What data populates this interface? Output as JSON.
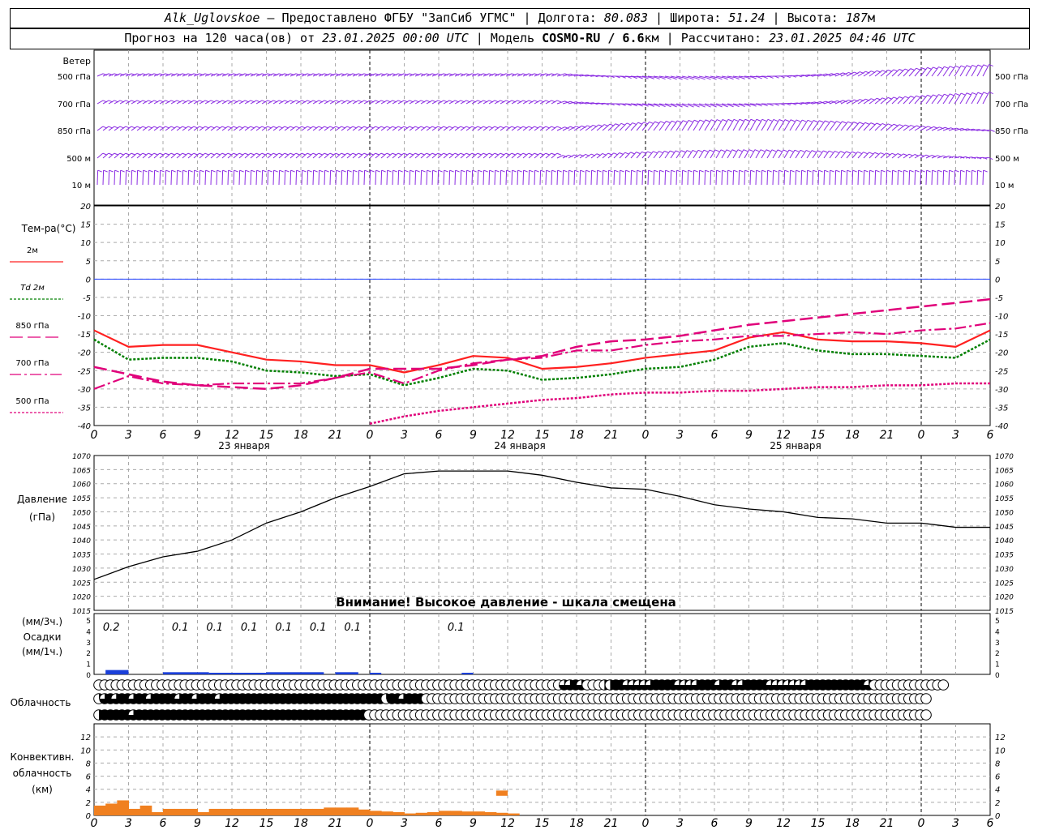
{
  "header": {
    "station": "Alk_Uglovskoe",
    "provider": "Предоставлено ФГБУ \"ЗапСиб УГМС\"",
    "lon_label": "Долгота:",
    "lon": "80.083",
    "lat_label": "Широта:",
    "lat": "51.24",
    "alt_label": "Высота:",
    "alt": "187",
    "alt_unit": "м",
    "forecast_prefix": "Прогноз на 120 часа(ов) от",
    "forecast_start": "23.01.2025 00:00 UTC",
    "model_label": "Модель",
    "model": "COSMO-RU / 6.6",
    "model_unit": "км",
    "calc_label": "Рассчитано:",
    "calc_time": "23.01.2025 04:46 UTC"
  },
  "labels": {
    "wind": "Ветер",
    "wind_levels": [
      "500 гПа",
      "700 гПа",
      "850 гПа",
      "500 м",
      "10 м"
    ],
    "temp": "Тем-ра(°С)",
    "temp_legend": [
      "2м",
      "Td  2м",
      "850 гПа",
      "700 гПа",
      "500 гПа"
    ],
    "pressure": "Давление",
    "pressure_unit": "(гПа)",
    "warning": "Внимание! Высокое давление - шкала смещена",
    "precip_unit3": "(мм/3ч.)",
    "precip": "Осадки",
    "precip_unit1": "(мм/1ч.)",
    "cloud": "Облачность",
    "conv1": "Конвективн.",
    "conv2": "облачность",
    "conv3": "(км)"
  },
  "time_axis": {
    "hour_ticks": [
      "0",
      "3",
      "6",
      "9",
      "12",
      "15",
      "18",
      "21",
      "0",
      "3",
      "6",
      "9",
      "12",
      "15",
      "18",
      "21",
      "0",
      "3",
      "6",
      "9",
      "12",
      "15",
      "18",
      "21",
      "0",
      "3",
      "6"
    ],
    "days": [
      "23 января",
      "24 января",
      "25 января"
    ]
  },
  "colors": {
    "wind": "#8a2be2",
    "t2m": "#ff2020",
    "td2m": "#008000",
    "t850": "#e0007a",
    "t700": "#e0007a",
    "t500": "#e0007a",
    "pressure": "#000000",
    "precip": "#1a3fd9",
    "conv": "#f08020",
    "zero_line": "#2040ff"
  },
  "chart_data": {
    "type": "line",
    "x_hours": [
      0,
      3,
      6,
      9,
      12,
      15,
      18,
      21,
      24,
      27,
      30,
      33,
      36,
      39,
      42,
      45,
      48,
      51,
      54,
      57,
      60,
      63,
      66,
      69,
      72,
      75,
      78
    ],
    "temperature": {
      "ylim": [
        -40,
        20
      ],
      "yticks": [
        "20",
        "15",
        "10",
        "5",
        "0",
        "-5",
        "-10",
        "-15",
        "-20",
        "-25",
        "-30",
        "-35",
        "-40"
      ],
      "series": [
        {
          "name": "2м",
          "values": [
            -14,
            -18.5,
            -18,
            -18,
            -20,
            -22,
            -22.5,
            -23.5,
            -23.5,
            -25.5,
            -23.5,
            -21,
            -21.5,
            -24.5,
            -24,
            -23,
            -21.5,
            -20.5,
            -19.5,
            -16,
            -14.5,
            -16.5,
            -17,
            -17,
            -17.5,
            -18.5,
            -14
          ]
        },
        {
          "name": "Td  2м",
          "values": [
            -16.5,
            -22,
            -21.5,
            -21.5,
            -22.5,
            -25,
            -25.5,
            -26.5,
            -26,
            -29,
            -27,
            -24.5,
            -25,
            -27.5,
            -27,
            -26,
            -24.5,
            -24,
            -22,
            -18.5,
            -17.5,
            -19.5,
            -20.5,
            -20.5,
            -21,
            -21.5,
            -16.5
          ]
        },
        {
          "name": "850 гПа",
          "values": [
            -24,
            -26,
            -28,
            -29,
            -29.5,
            -30,
            -29,
            -27,
            -24.5,
            -24.5,
            -24.5,
            -23.5,
            -22,
            -21,
            -18.5,
            -17,
            -16.5,
            -15.5,
            -14,
            -12.5,
            -11.5,
            -10.5,
            -9.5,
            -8.5,
            -7.5,
            -6.5,
            -5.5
          ]
        },
        {
          "name": "700 гПа",
          "values": [
            -30,
            -26.5,
            -28.5,
            -29,
            -28.5,
            -28.5,
            -28.5,
            -27,
            -25.5,
            -28.5,
            -25,
            -23,
            -22,
            -21.5,
            -19.5,
            -19.5,
            -18,
            -17,
            -16.5,
            -15.5,
            -15.5,
            -15,
            -14.5,
            -15,
            -14,
            -13.5,
            -12
          ]
        },
        {
          "name": "500 гПа",
          "values": [
            null,
            null,
            null,
            null,
            null,
            null,
            null,
            null,
            -39.5,
            -37.5,
            -36,
            -35,
            -34,
            -33,
            -32.5,
            -31.5,
            -31,
            -31,
            -30.5,
            -30.5,
            -30,
            -29.5,
            -29.5,
            -29,
            -29,
            -28.5,
            -28.5
          ]
        }
      ]
    },
    "pressure": {
      "ylim": [
        1015,
        1070
      ],
      "yticks": [
        "1070",
        "1065",
        "1060",
        "1055",
        "1050",
        "1045",
        "1040",
        "1035",
        "1030",
        "1025",
        "1020",
        "1015"
      ],
      "values": [
        1026,
        1030.5,
        1034,
        1036,
        1040,
        1046,
        1050,
        1055,
        1059,
        1063.5,
        1064.5,
        1064.5,
        1064.5,
        1063,
        1060.5,
        1058.5,
        1058,
        1055.5,
        1052.5,
        1051,
        1050,
        1048,
        1047.5,
        1046,
        1046,
        1044.5,
        1044.5
      ]
    },
    "precip": {
      "yticks": [
        "5",
        "4",
        "3",
        "2",
        "1",
        "0"
      ],
      "labels": [
        {
          "h": 1,
          "v": "0.2"
        },
        {
          "h": 7,
          "v": "0.1"
        },
        {
          "h": 10,
          "v": "0.1"
        },
        {
          "h": 13,
          "v": "0.1"
        },
        {
          "h": 16,
          "v": "0.1"
        },
        {
          "h": 19,
          "v": "0.1"
        },
        {
          "h": 22,
          "v": "0.1"
        },
        {
          "h": 31,
          "v": "0.1"
        }
      ],
      "bars": [
        {
          "h0": 1,
          "h1": 3,
          "v": 0.2
        },
        {
          "h0": 6,
          "h1": 10,
          "v": 0.1
        },
        {
          "h0": 10,
          "h1": 15,
          "v": 0.05
        },
        {
          "h0": 15,
          "h1": 20,
          "v": 0.1
        },
        {
          "h0": 21,
          "h1": 23,
          "v": 0.1
        },
        {
          "h0": 24,
          "h1": 25,
          "v": 0.05
        },
        {
          "h0": 32,
          "h1": 33,
          "v": 0.05
        }
      ]
    },
    "conv": {
      "ylim": [
        0,
        14
      ],
      "yticks": [
        "12",
        "10",
        "8",
        "6",
        "4",
        "2",
        "0"
      ],
      "bars": [
        [
          0,
          1.5
        ],
        [
          1,
          1.8
        ],
        [
          2,
          2.3
        ],
        [
          3,
          1
        ],
        [
          4,
          1.5
        ],
        [
          5,
          0.5
        ],
        [
          6,
          1
        ],
        [
          7,
          1
        ],
        [
          8,
          1
        ],
        [
          9,
          0.5
        ],
        [
          10,
          1
        ],
        [
          11,
          1
        ],
        [
          12,
          1
        ],
        [
          13,
          1
        ],
        [
          14,
          1
        ],
        [
          15,
          1
        ],
        [
          16,
          1
        ],
        [
          17,
          1
        ],
        [
          18,
          1
        ],
        [
          19,
          1
        ],
        [
          20,
          1.2
        ],
        [
          21,
          1.2
        ],
        [
          22,
          1.2
        ],
        [
          23,
          0.9
        ],
        [
          24,
          0.7
        ],
        [
          25,
          0.6
        ],
        [
          26,
          0.5
        ],
        [
          27,
          0.3
        ],
        [
          28,
          0.4
        ],
        [
          29,
          0.5
        ],
        [
          30,
          0.7
        ],
        [
          31,
          0.7
        ],
        [
          32,
          0.6
        ],
        [
          33,
          0.6
        ],
        [
          34,
          0.5
        ],
        [
          35,
          0.4
        ],
        [
          36,
          0.3
        ]
      ],
      "extra": [
        {
          "h0": 35,
          "h1": 36,
          "v0": 3,
          "v1": 3.8
        }
      ]
    },
    "cloud": {
      "rows": [
        "0000000000000000000000000000000000000000000000000000000000000000000000000000000003343000224433333444433334443443344443333333444444444430000000000000",
        "1343443443444434434443444444444444444444444444444414434440000000000000000000000000000000000000000000000000000000000000000000000000000000000000000",
        "2444443444444444444444444444444444444444444444400000000000000000000000000000000000000000000000000000000000000000000000000000000000000000000000000"
      ]
    }
  }
}
